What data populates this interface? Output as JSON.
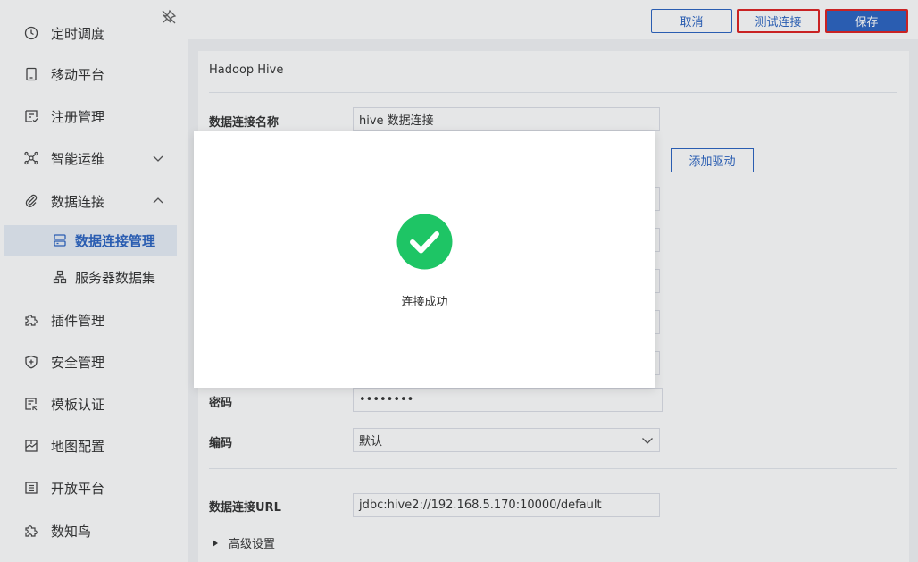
{
  "sidebar": {
    "items": [
      {
        "label": "定时调度",
        "icon": "clock-icon"
      },
      {
        "label": "移动平台",
        "icon": "tablet-icon"
      },
      {
        "label": "注册管理",
        "icon": "register-icon"
      },
      {
        "label": "智能运维",
        "icon": "network-icon",
        "expandable": true,
        "expanded": false
      },
      {
        "label": "数据连接",
        "icon": "paperclip-icon",
        "expandable": true,
        "expanded": true
      },
      {
        "label": "数据连接管理",
        "icon": "database-icon",
        "active": true
      },
      {
        "label": "服务器数据集",
        "icon": "hierarchy-icon"
      },
      {
        "label": "插件管理",
        "icon": "puzzle-icon"
      },
      {
        "label": "安全管理",
        "icon": "shield-icon"
      },
      {
        "label": "模板认证",
        "icon": "certificate-icon"
      },
      {
        "label": "地图配置",
        "icon": "map-icon"
      },
      {
        "label": "开放平台",
        "icon": "list-icon"
      },
      {
        "label": "数知鸟",
        "icon": "bird-icon"
      }
    ]
  },
  "toolbar": {
    "cancel_label": "取消",
    "test_label": "测试连接",
    "save_label": "保存"
  },
  "form": {
    "title": "Hadoop Hive",
    "name_label": "数据连接名称",
    "name_value": "hive 数据连接",
    "add_driver_label": "添加驱动",
    "password_label": "密码",
    "password_value": "••••••••",
    "encoding_label": "编码",
    "encoding_value": "默认",
    "url_label": "数据连接URL",
    "url_value": "jdbc:hive2://192.168.5.170:10000/default",
    "advanced_label": "高级设置"
  },
  "dialog": {
    "message": "连接成功",
    "icon": "check-circle-icon",
    "color": "#1ec565"
  },
  "colors": {
    "accent": "#2b64c2",
    "highlight_border": "#e02020"
  }
}
